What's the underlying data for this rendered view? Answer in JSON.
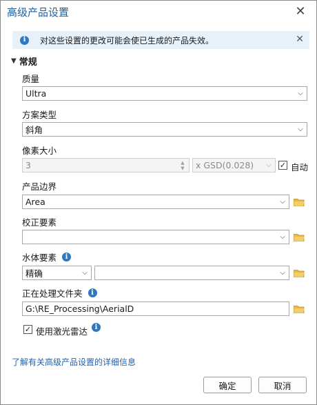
{
  "dialog": {
    "title": "高级产品设置"
  },
  "info_bar": {
    "message": "对这些设置的更改可能会使已生成的产品失效。"
  },
  "section": {
    "title": "常规"
  },
  "fields": {
    "quality": {
      "label": "质量",
      "value": "Ultra"
    },
    "scheme_type": {
      "label": "方案类型",
      "value": "斜角"
    },
    "pixel_size": {
      "label": "像素大小",
      "value": "3",
      "unit": "x GSD(0.028)",
      "auto_label": "自动",
      "auto_checked": true
    },
    "product_boundary": {
      "label": "产品边界",
      "value": "Area"
    },
    "correction_features": {
      "label": "校正要素",
      "value": ""
    },
    "water_features": {
      "label": "水体要素",
      "mode": "精确",
      "value": ""
    },
    "processing_folder": {
      "label": "正在处理文件夹",
      "value": "G:\\RE_Processing\\AerialD"
    },
    "use_lidar": {
      "label": "使用激光雷达",
      "checked": true
    }
  },
  "link": {
    "text": "了解有关高级产品设置的详细信息"
  },
  "buttons": {
    "ok": "确定",
    "cancel": "取消"
  },
  "colors": {
    "accent": "#1f5f9e",
    "info_bg": "#e7f1fa",
    "info_icon": "#2e78c2",
    "folder": "#e8b84a"
  }
}
